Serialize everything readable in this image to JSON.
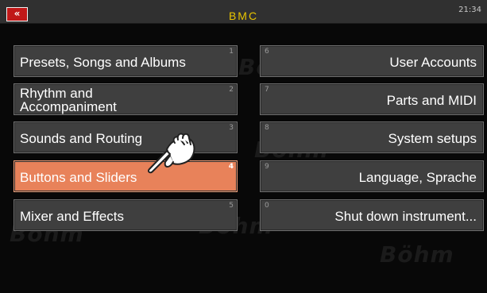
{
  "header": {
    "back_label": "«",
    "title": "BMC",
    "clock": "21:34"
  },
  "watermark": {
    "brand": "Böhm"
  },
  "menu": {
    "left": [
      {
        "num": "1",
        "label": "Presets, Songs and Albums"
      },
      {
        "num": "2",
        "label_line1": "Rhythm and",
        "label_line2": "Accompaniment"
      },
      {
        "num": "3",
        "label": "Sounds and Routing"
      },
      {
        "num": "4",
        "label": "Buttons and Sliders",
        "selected": true
      },
      {
        "num": "5",
        "label": "Mixer and Effects"
      }
    ],
    "right": [
      {
        "num": "6",
        "label": "User Accounts"
      },
      {
        "num": "7",
        "label": "Parts and MIDI"
      },
      {
        "num": "8",
        "label": "System setups"
      },
      {
        "num": "9",
        "label": "Language, Sprache"
      },
      {
        "num": "0",
        "label": "Shut down instrument..."
      }
    ]
  },
  "colors": {
    "title": "#e8c400",
    "button_bg": "#3f3f3f",
    "selected_bg": "#e8825a",
    "back_button": "#c01818"
  },
  "icons": {
    "pointer": "pointing-hand-icon"
  }
}
